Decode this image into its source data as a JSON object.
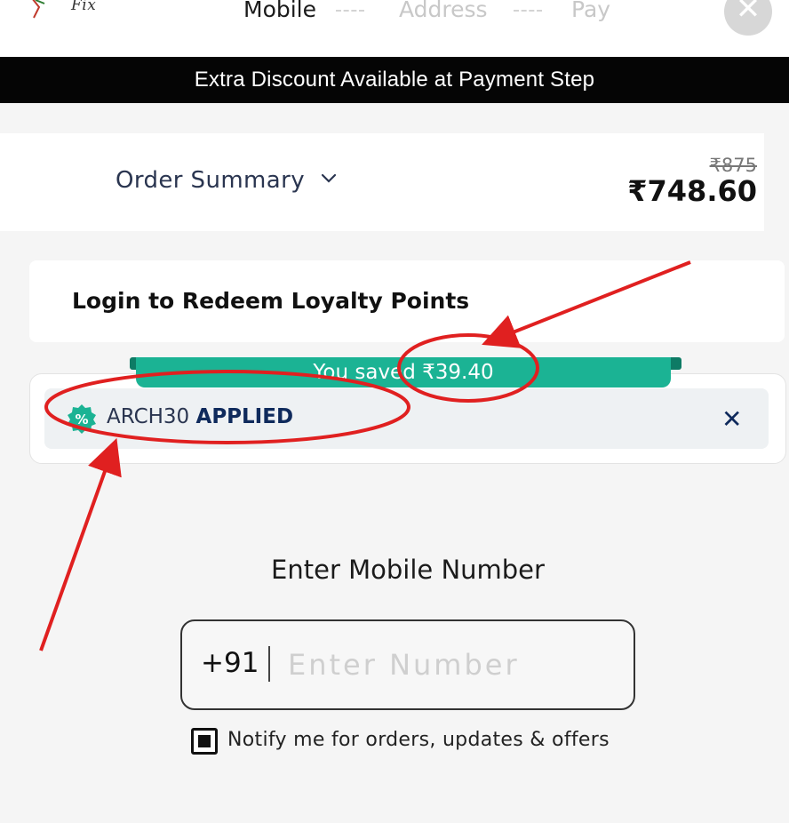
{
  "header": {
    "logo_text": "Fix",
    "steps": [
      {
        "label": "Mobile",
        "active": true
      },
      {
        "label": "Address",
        "active": false
      },
      {
        "label": "Pay",
        "active": false
      }
    ],
    "close_icon": "close-icon"
  },
  "banner": {
    "text": "Extra Discount Available at Payment Step"
  },
  "order_summary": {
    "label": "Order Summary",
    "original_price": "₹875",
    "final_price": "₹748.60"
  },
  "loyalty": {
    "text": "Login to Redeem Loyalty Points"
  },
  "coupon": {
    "saved_text": "You saved ₹39.40",
    "code": "ARCH30",
    "status": "APPLIED",
    "remove_icon": "close-icon"
  },
  "mobile": {
    "title": "Enter Mobile Number",
    "country_code": "+91",
    "placeholder": "Enter Number",
    "value": "",
    "notify_label": "Notify me for orders, updates & offers",
    "notify_checked": true
  },
  "colors": {
    "banner_bg": "#050505",
    "ribbon": "#1bb394",
    "annotation": "#e02020",
    "coupon_text": "#0f2a5c"
  }
}
